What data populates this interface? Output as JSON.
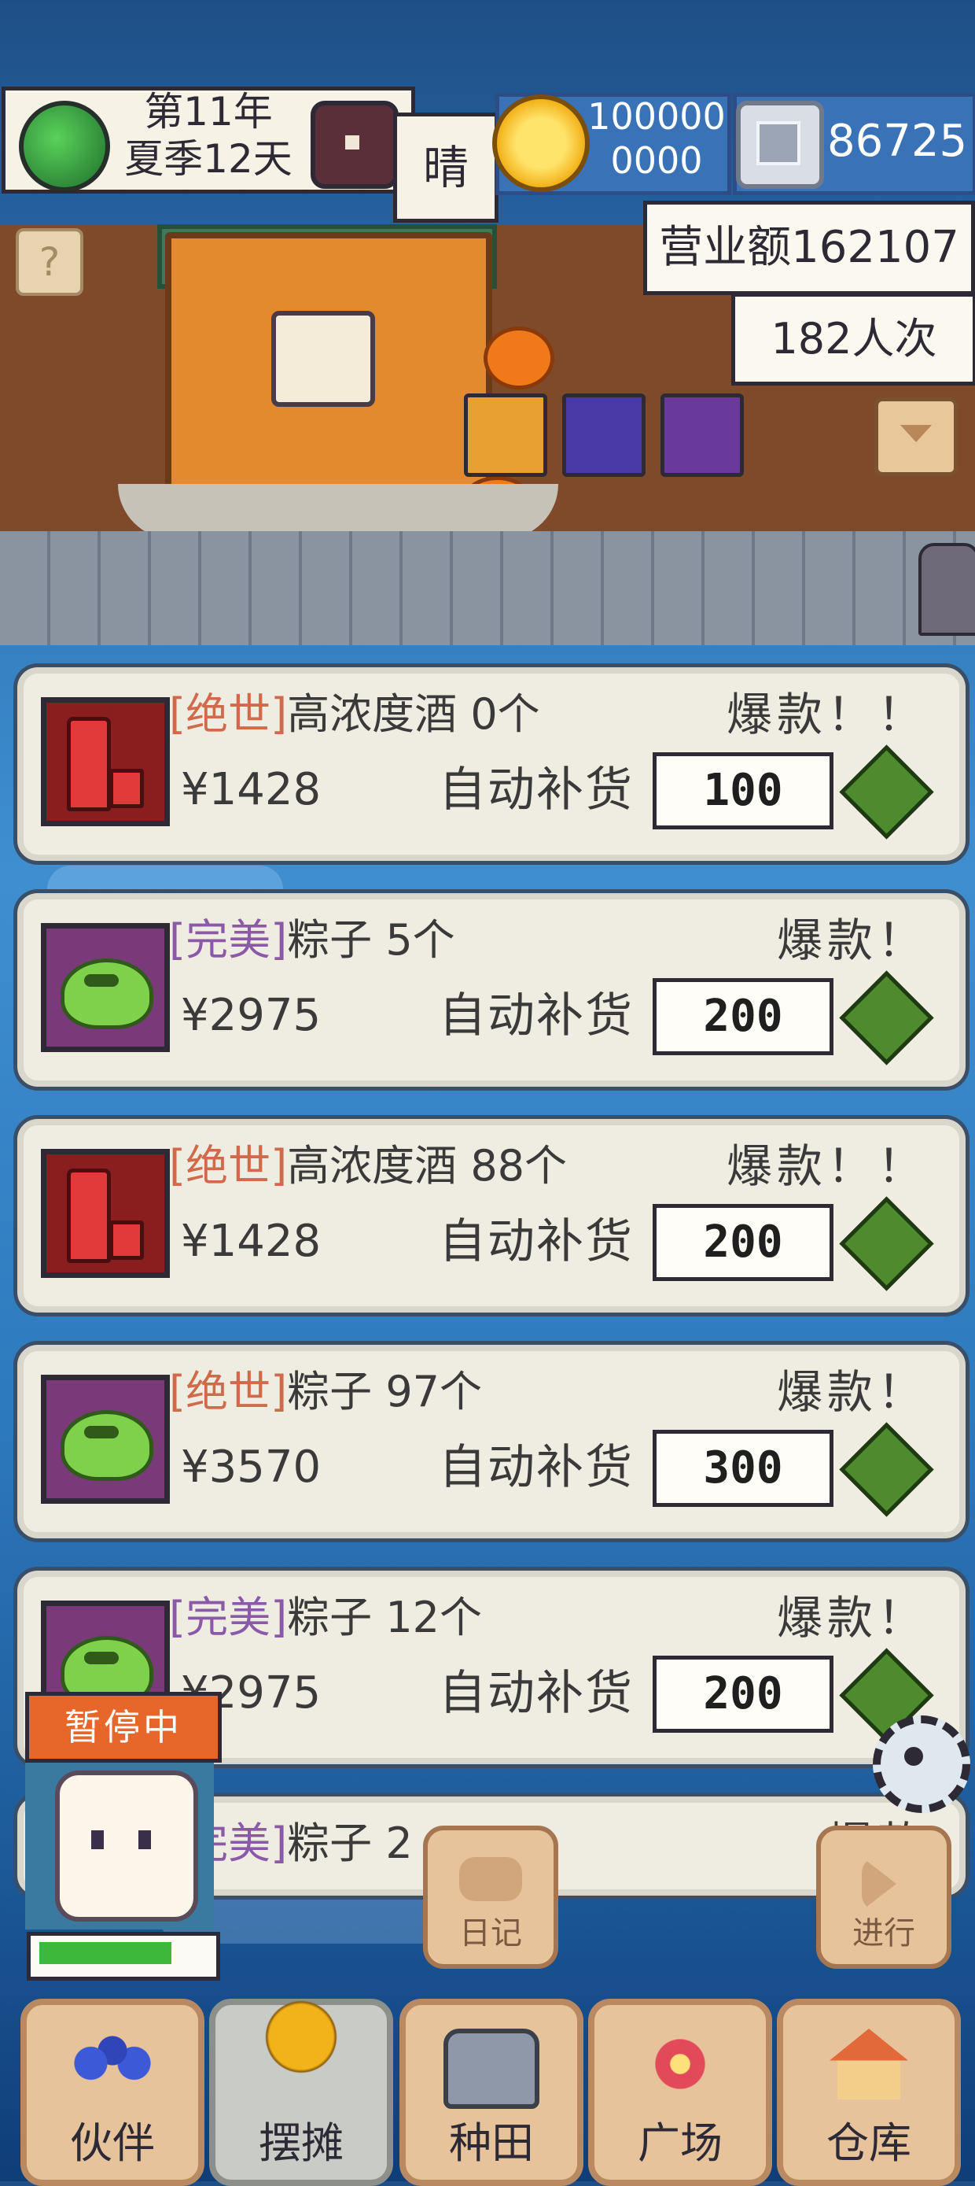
{
  "status": {
    "date_line1": "第11年",
    "date_line2": "夏季12天",
    "weather": "晴",
    "gold": "1000000000",
    "gold_line1": "100000",
    "gold_line2": "0000",
    "silver": "86725"
  },
  "shop": {
    "revenue": "营业额162107",
    "visitors": "182人次",
    "help": "?"
  },
  "products": [
    {
      "quality": "[绝世]",
      "quality_color": "#d06a4a",
      "name": "高浓度酒",
      "count": "0个",
      "hot": "爆款！！",
      "price": "¥1428",
      "auto_label": "自动补货",
      "restock": "100",
      "icon": "wine-bottle"
    },
    {
      "quality": "[完美]",
      "quality_color": "#8a5aa8",
      "name": "粽子",
      "count": "5个",
      "hot": "爆款！",
      "price": "¥2975",
      "auto_label": "自动补货",
      "restock": "200",
      "icon": "zongzi"
    },
    {
      "quality": "[绝世]",
      "quality_color": "#d06a4a",
      "name": "高浓度酒",
      "count": "88个",
      "hot": "爆款！！",
      "price": "¥1428",
      "auto_label": "自动补货",
      "restock": "200",
      "icon": "wine-bottle"
    },
    {
      "quality": "[绝世]",
      "quality_color": "#d06a4a",
      "name": "粽子",
      "count": "97个",
      "hot": "爆款！",
      "price": "¥3570",
      "auto_label": "自动补货",
      "restock": "300",
      "icon": "zongzi"
    },
    {
      "quality": "[完美]",
      "quality_color": "#8a5aa8",
      "name": "粽子",
      "count": "12个",
      "hot": "爆款！",
      "price": "¥2975",
      "auto_label": "自动补货",
      "restock": "200",
      "icon": "zongzi"
    },
    {
      "quality": "[完美]",
      "quality_color": "#8a5aa8",
      "name": "粽子",
      "count": "2",
      "hot": "爆款",
      "price": "",
      "auto_label": "",
      "restock": "",
      "icon": "zongzi"
    }
  ],
  "overlay": {
    "pause_label": "暂停中",
    "hp_fraction": 0.78,
    "diary_label": "日记",
    "proceed_label": "进行"
  },
  "nav": [
    {
      "label": "伙伴",
      "icon": "people-icon",
      "active": false
    },
    {
      "label": "摆摊",
      "icon": "coins-icon",
      "active": true
    },
    {
      "label": "种田",
      "icon": "watering-can-icon",
      "active": false
    },
    {
      "label": "广场",
      "icon": "flower-icon",
      "active": false
    },
    {
      "label": "仓库",
      "icon": "house-icon",
      "active": false
    }
  ]
}
